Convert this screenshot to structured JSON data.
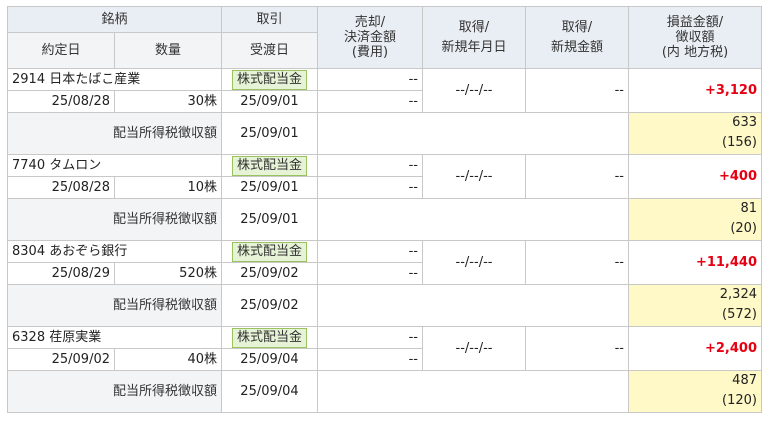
{
  "headers": {
    "col1_top": "銘柄",
    "col1_sub_date": "約定日",
    "col1_sub_qty": "数量",
    "col2_top": "取引",
    "col2_sub": "受渡日",
    "col3_l1": "売却/",
    "col3_l2": "決済金額",
    "col3_l3": "(費用)",
    "col4_l1": "取得/",
    "col4_l2": "新規年月日",
    "col5_l1": "取得/",
    "col5_l2": "新規金額",
    "col6_l1": "損益金額/",
    "col6_l2": "徴収額",
    "col6_l3": "(内 地方税)"
  },
  "rows": [
    {
      "name": "2914 日本たばこ産業",
      "trade_date": "25/08/28",
      "qty": "30株",
      "trade_type": "株式配当金",
      "settle_date": "25/09/01",
      "sale_top": "--",
      "sale_bottom": "--",
      "acq_date": "--/--/--",
      "acq_amount": "--",
      "profit": "+3,120",
      "tax_label": "配当所得税徴収額",
      "tax_date": "25/09/01",
      "tax_amount": "633",
      "tax_local": "(156)"
    },
    {
      "name": "7740 タムロン",
      "trade_date": "25/08/28",
      "qty": "10株",
      "trade_type": "株式配当金",
      "settle_date": "25/09/01",
      "sale_top": "--",
      "sale_bottom": "--",
      "acq_date": "--/--/--",
      "acq_amount": "--",
      "profit": "+400",
      "tax_label": "配当所得税徴収額",
      "tax_date": "25/09/01",
      "tax_amount": "81",
      "tax_local": "(20)"
    },
    {
      "name": "8304 あおぞら銀行",
      "trade_date": "25/08/29",
      "qty": "520株",
      "trade_type": "株式配当金",
      "settle_date": "25/09/02",
      "sale_top": "--",
      "sale_bottom": "--",
      "acq_date": "--/--/--",
      "acq_amount": "--",
      "profit": "+11,440",
      "tax_label": "配当所得税徴収額",
      "tax_date": "25/09/02",
      "tax_amount": "2,324",
      "tax_local": "(572)"
    },
    {
      "name": "6328 荏原実業",
      "trade_date": "25/09/02",
      "qty": "40株",
      "trade_type": "株式配当金",
      "settle_date": "25/09/04",
      "sale_top": "--",
      "sale_bottom": "--",
      "acq_date": "--/--/--",
      "acq_amount": "--",
      "profit": "+2,400",
      "tax_label": "配当所得税徴収額",
      "tax_date": "25/09/04",
      "tax_amount": "487",
      "tax_local": "(120)"
    }
  ]
}
